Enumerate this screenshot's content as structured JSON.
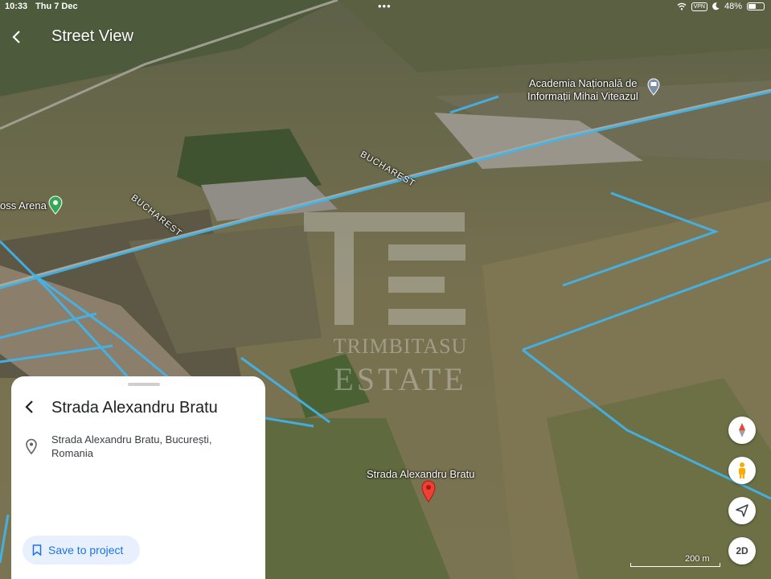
{
  "status": {
    "time": "10:33",
    "date": "Thu 7 Dec",
    "vpn": "VPN",
    "battery_percent": "48%",
    "battery_level": 0.48
  },
  "header": {
    "title": "Street View"
  },
  "map_labels": {
    "academy_line1": "Academia Națională de",
    "academy_line2": "Informații Mihai Viteazul",
    "arena": "oss Arena",
    "road_1": "BUCHAREST",
    "road_2": "BUCHAREST",
    "pin": "Strada Alexandru Bratu"
  },
  "watermark": {
    "line1": "TRIMBITASU",
    "line2": "ESTATE"
  },
  "place_sheet": {
    "title": "Strada Alexandru Bratu",
    "address": "Strada Alexandru Bratu, București, Romania",
    "save_label": "Save to project"
  },
  "controls": {
    "view_mode": "2D"
  },
  "scale": {
    "label": "200 m"
  },
  "colors": {
    "boundary": "#3fb6f0",
    "pin": "#ea4335",
    "accent": "#1a73e8"
  }
}
